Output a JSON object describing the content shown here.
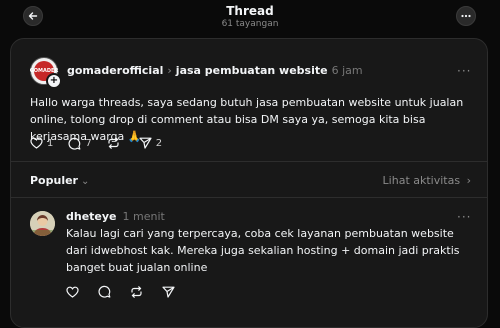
{
  "header": {
    "title": "Thread",
    "subtitle": "61 tayangan",
    "back_icon": "arrow-left-icon",
    "more_icon": "more-horizontal-icon"
  },
  "post": {
    "avatar_text": "GOMADER",
    "author": "gomaderofficial",
    "topic": "jasa pembuatan website",
    "time": "6 jam",
    "text": "Hallo warga threads, saya sedang butuh jasa pembuatan website untuk jualan online, tolong drop di comment atau bisa DM saya ya, semoga kita bisa kerjasama warga 🙏",
    "likes": "1",
    "comments": "7",
    "reposts": "",
    "shares": "2"
  },
  "replies_bar": {
    "sort_label": "Populer",
    "activity_label": "Lihat aktivitas"
  },
  "reply": {
    "author": "dheteye",
    "time": "1 menit",
    "text": "Kalau lagi cari yang terpercaya, coba cek layanan pembuatan website dari idwebhost kak. Mereka juga sekalian hosting + domain jadi praktis banget buat jualan online"
  },
  "colors": {
    "background": "#0a0a0a",
    "card": "#181818",
    "text": "#f3f5f7",
    "muted": "#8a8a8a"
  }
}
